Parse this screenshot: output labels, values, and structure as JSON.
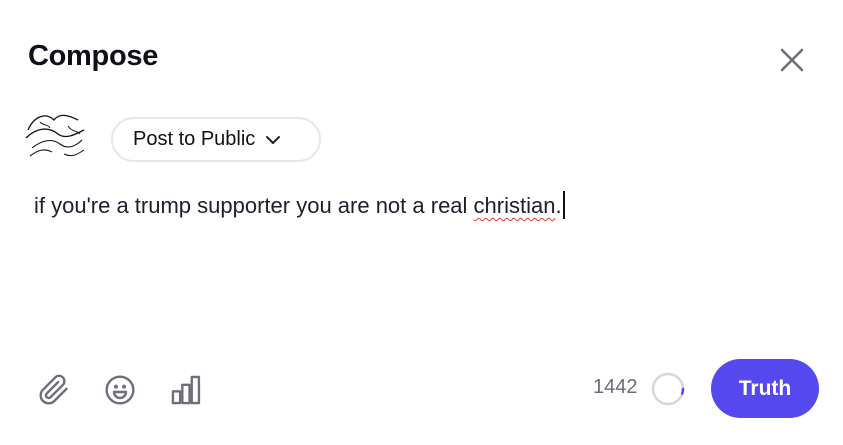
{
  "header": {
    "title": "Compose",
    "close_icon": "close-icon"
  },
  "composer": {
    "audience_label": "Post to Public",
    "audience_icon": "chevron-down-icon",
    "text_before": "if you're a trump supporter you are not a real ",
    "text_misspelled": "christian",
    "text_after": "."
  },
  "toolbar": {
    "icons": [
      "paperclip-icon",
      "emoji-icon",
      "poll-icon"
    ],
    "char_counter": "1442",
    "post_label": "Truth"
  },
  "colors": {
    "accent": "#5448ee",
    "text": "#1e1e2c",
    "muted": "#6b6b78",
    "border": "#e6e6ec",
    "spellcheck": "#e53935"
  }
}
